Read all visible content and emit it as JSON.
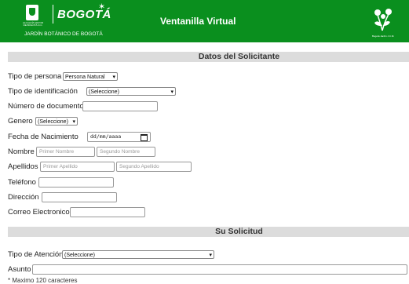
{
  "header": {
    "seal_text": "ALCALDÍA MAYOR DE BOGOTÁ D.C.",
    "city": "BOGOTÁ",
    "org": "JARDÍN BOTÁNICO DE BOGOTÁ",
    "app_title": "Ventanilla Virtual",
    "flower_caption": "Bogotá Jardín J.C.M.",
    "brand_color": "#0a8f1e"
  },
  "section1": {
    "title": "Datos del Solicitante"
  },
  "form": {
    "tipo_persona": {
      "label": "Tipo de persona",
      "value": "Persona Natural"
    },
    "tipo_id": {
      "label": "Tipo de identificación",
      "value": "(Seleccione)"
    },
    "num_doc": {
      "label": "Número de documento"
    },
    "genero": {
      "label": "Genero",
      "value": "(Seleccione)"
    },
    "fecha": {
      "label": "Fecha de Nacimiento",
      "placeholder": "dd/mm/aaaa"
    },
    "nombre": {
      "label": "Nombre",
      "ph1": "Primer Nombre",
      "ph2": "Segundo Nombre"
    },
    "apellidos": {
      "label": "Apellidos",
      "ph1": "Primer Apellido",
      "ph2": "Segundo Apellido"
    },
    "telefono": {
      "label": "Teléfono"
    },
    "direccion": {
      "label": "Dirección"
    },
    "correo": {
      "label": "Correo Electronico"
    }
  },
  "section2": {
    "title": "Su Solicitud"
  },
  "solicitud": {
    "tipo_atencion": {
      "label": "Tipo de Atención",
      "value": "(Seleccione)"
    },
    "asunto": {
      "label": "Asunto"
    },
    "note": "* Maximo 120 caracteres"
  }
}
